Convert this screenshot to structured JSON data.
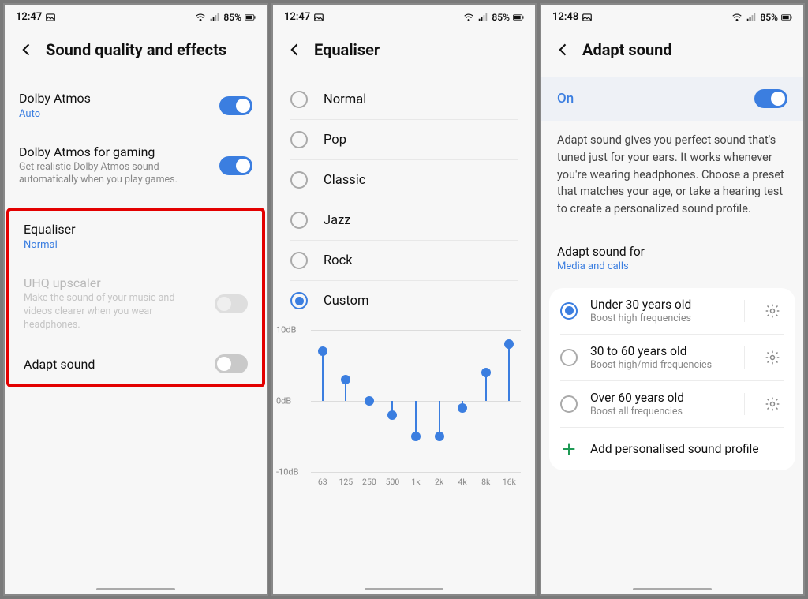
{
  "status": {
    "time_a": "12:47",
    "time_b": "12:47",
    "time_c": "12:48",
    "battery": "85%"
  },
  "screen1": {
    "title": "Sound quality and effects",
    "dolby": {
      "title": "Dolby Atmos",
      "sub": "Auto",
      "on": true
    },
    "dolby_gaming": {
      "title": "Dolby Atmos for gaming",
      "sub": "Get realistic Dolby Atmos sound automatically when you play games.",
      "on": true
    },
    "equaliser": {
      "title": "Equaliser",
      "sub": "Normal"
    },
    "uhq": {
      "title": "UHQ upscaler",
      "sub": "Make the sound of your music and videos clearer when you wear headphones.",
      "on": false,
      "disabled": true
    },
    "adapt": {
      "title": "Adapt sound",
      "on": false
    }
  },
  "screen2": {
    "title": "Equaliser",
    "options": [
      {
        "label": "Normal",
        "selected": false
      },
      {
        "label": "Pop",
        "selected": false
      },
      {
        "label": "Classic",
        "selected": false
      },
      {
        "label": "Jazz",
        "selected": false
      },
      {
        "label": "Rock",
        "selected": false
      },
      {
        "label": "Custom",
        "selected": true
      }
    ]
  },
  "screen3": {
    "title": "Adapt sound",
    "on_label": "On",
    "on": true,
    "description": "Adapt sound gives you perfect sound that's tuned just for your ears. It works whenever you're wearing headphones. Choose a preset that matches your age, or take a hearing test to create a personalized sound profile.",
    "adapt_for": {
      "title": "Adapt sound for",
      "value": "Media and calls"
    },
    "ages": [
      {
        "label": "Under 30 years old",
        "sub": "Boost high frequencies",
        "selected": true
      },
      {
        "label": "30 to 60 years old",
        "sub": "Boost high/mid frequencies",
        "selected": false
      },
      {
        "label": "Over 60 years old",
        "sub": "Boost all frequencies",
        "selected": false
      }
    ],
    "add_profile": "Add personalised sound profile"
  },
  "chart_data": {
    "type": "bar",
    "title": "",
    "xlabel": "",
    "ylabel": "",
    "categories": [
      "63",
      "125",
      "250",
      "500",
      "1k",
      "2k",
      "4k",
      "8k",
      "16k"
    ],
    "values": [
      7,
      3,
      0,
      -2,
      -5,
      -5,
      -1,
      4,
      8
    ],
    "ylim": [
      -10,
      10
    ],
    "yticks": [
      {
        "v": 10,
        "label": "10dB"
      },
      {
        "v": 0,
        "label": "0dB"
      },
      {
        "v": -10,
        "label": "-10dB"
      }
    ]
  }
}
